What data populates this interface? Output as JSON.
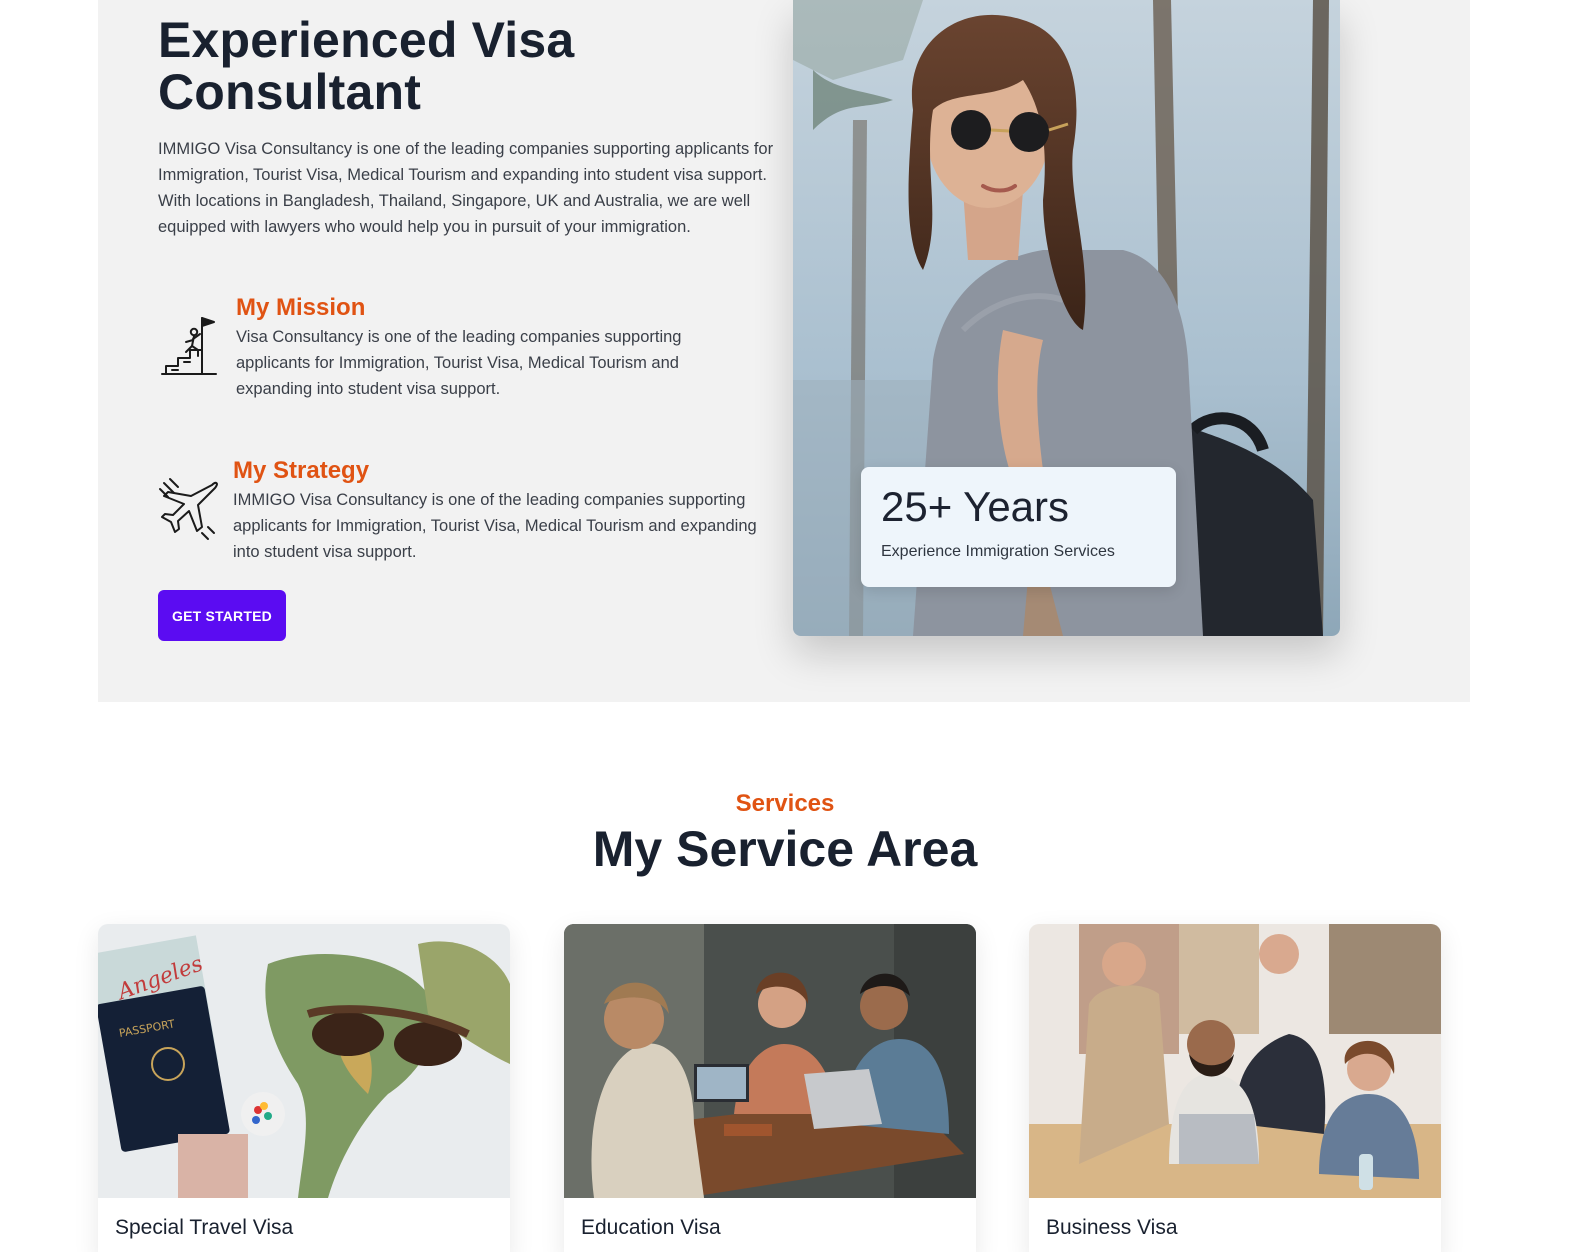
{
  "about": {
    "title_line1": "Experienced Visa",
    "title_line2": "Consultant",
    "description": "IMMIGO Visa Consultancy is one of the leading companies supporting applicants for Immigration, Tourist Visa, Medical Tourism and expanding into student visa support. With locations in Bangladesh, Thailand, Singapore, UK and Australia, we are well equipped with lawyers who would help you in pursuit of your immigration.",
    "features": [
      {
        "icon": "mountain-flag-icon",
        "title": "My Mission",
        "text": "Visa Consultancy is one of the leading companies supporting applicants for Immigration, Tourist Visa, Medical Tourism and expanding into student visa support."
      },
      {
        "icon": "airplane-icon",
        "title": "My Strategy",
        "text": "IMMIGO Visa Consultancy is one of the leading companies supporting applicants for Immigration, Tourist Visa, Medical Tourism and expanding into student visa support."
      }
    ],
    "cta_label": "GET STARTED",
    "experience": {
      "years": "25+ Years",
      "label": "Experience Immigration Services"
    }
  },
  "services": {
    "tag": "Services",
    "title": "My Service Area",
    "cards": [
      {
        "title": "Special Travel Visa",
        "image": "passport-and-map-photo"
      },
      {
        "title": "Education Visa",
        "image": "students-with-laptops-photo"
      },
      {
        "title": "Business Visa",
        "image": "team-at-laptop-photo"
      }
    ]
  },
  "colors": {
    "accent": "#e05313",
    "button": "#5b0cf2",
    "heading": "#19212f",
    "hero_bg": "#f2f2f2"
  }
}
